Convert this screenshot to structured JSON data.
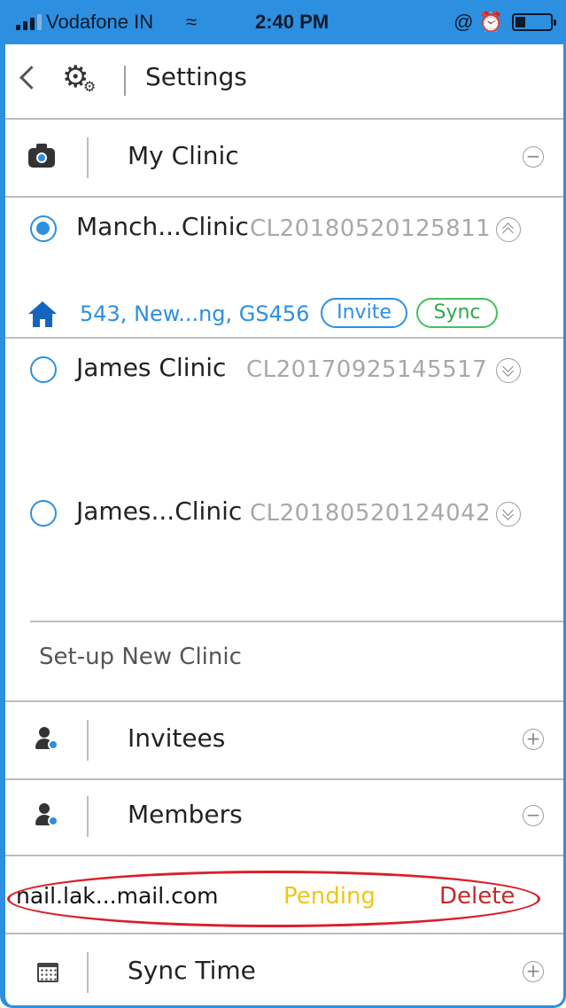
{
  "status_bar": {
    "carrier": "Vodafone IN",
    "time": "2:40 PM",
    "wifi_icon": "wifi-icon",
    "alarm_icons": "@ ⏰",
    "battery_level": 0.3
  },
  "header": {
    "title": "Settings"
  },
  "sections": {
    "my_clinic": {
      "label": "My Clinic",
      "toggle": "−"
    },
    "invitees": {
      "label": "Invitees",
      "toggle": "+"
    },
    "members": {
      "label": "Members",
      "toggle": "−"
    },
    "sync_time": {
      "label": "Sync Time",
      "toggle": "+"
    }
  },
  "clinics": [
    {
      "name": "Manch...Clinic",
      "code": "CL20180520125811",
      "selected": true,
      "expanded": true
    },
    {
      "name": "James Clinic",
      "code": "CL20170925145517",
      "selected": false,
      "expanded": false
    },
    {
      "name": "James...Clinic",
      "code": "CL20180520124042",
      "selected": false,
      "expanded": false
    }
  ],
  "address": {
    "text": "543, New...ng, GS456",
    "invite_label": "Invite",
    "sync_label": "Sync"
  },
  "setup": {
    "label": "Set-up New Clinic"
  },
  "member_entry": {
    "email": "nail.lak...mail.com",
    "status": "Pending",
    "delete_label": "Delete"
  },
  "colors": {
    "accent": "#2d8fe0",
    "pending": "#f0c419",
    "delete": "#c62828",
    "sync_green": "#43c05c",
    "highlight": "#d9202a"
  }
}
